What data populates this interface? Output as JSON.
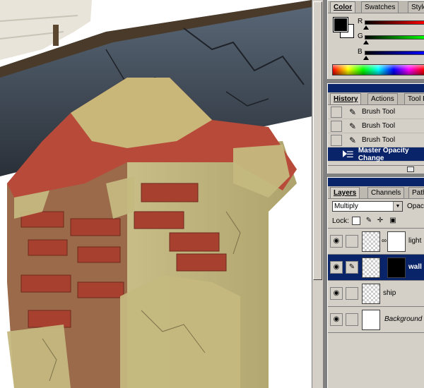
{
  "color_panel": {
    "tabs": [
      "Color",
      "Swatches",
      "Styles"
    ],
    "active_tab": "Color",
    "foreground": "#000000",
    "background": "#ffffff",
    "sliders": [
      {
        "label": "R",
        "gradient": "linear-gradient(to right,#000,#ff0000)"
      },
      {
        "label": "G",
        "gradient": "linear-gradient(to right,#000,#00ff00)"
      },
      {
        "label": "B",
        "gradient": "linear-gradient(to right,#000,#0000ff)"
      }
    ]
  },
  "history_panel": {
    "tabs": [
      "History",
      "Actions",
      "Tool Presets"
    ],
    "active_tab": "History",
    "items": [
      {
        "label": "Brush Tool",
        "icon": "brush-icon",
        "selected": false
      },
      {
        "label": "Brush Tool",
        "icon": "brush-icon",
        "selected": false
      },
      {
        "label": "Brush Tool",
        "icon": "brush-icon",
        "selected": false
      },
      {
        "label": "Master Opacity Change",
        "icon": "layer-opacity-icon",
        "selected": true
      }
    ]
  },
  "layers_panel": {
    "tabs": [
      "Layers",
      "Channels",
      "Paths"
    ],
    "active_tab": "Layers",
    "blend_mode": "Multiply",
    "opacity_label": "Opacity:",
    "lock_label": "Lock:",
    "layers": [
      {
        "name": "light",
        "visible": true,
        "has_mask": true,
        "mask_dark": false,
        "selected": false,
        "italic": false
      },
      {
        "name": "wall",
        "visible": true,
        "has_mask": true,
        "mask_dark": true,
        "selected": true,
        "italic": false
      },
      {
        "name": "ship",
        "visible": true,
        "has_mask": false,
        "mask_dark": false,
        "selected": false,
        "italic": false
      },
      {
        "name": "Background",
        "visible": true,
        "has_mask": false,
        "mask_dark": false,
        "selected": false,
        "italic": true
      }
    ]
  },
  "colors": {
    "panel_bg": "#d4d0c8",
    "title_bar": "#0a246a",
    "selection": "#0a246a"
  }
}
